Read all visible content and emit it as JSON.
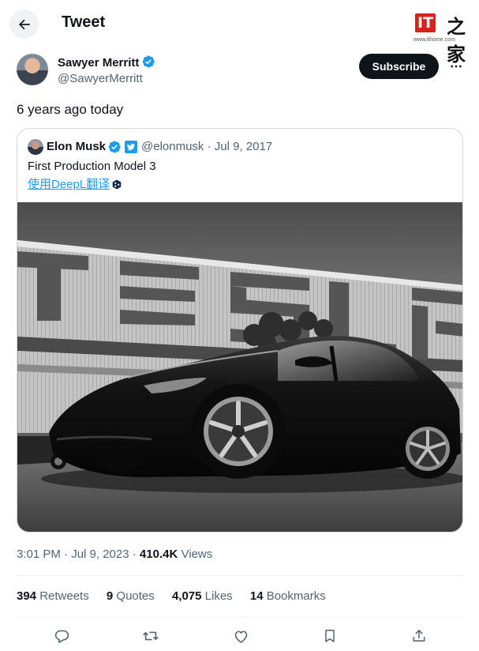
{
  "header": {
    "title": "Tweet"
  },
  "watermark": {
    "logo_it": "IT",
    "logo_glyph": "之家",
    "url": "www.ithome.com"
  },
  "author": {
    "name": "Sawyer Merritt",
    "handle": "@SawyerMerritt",
    "subscribe_label": "Subscribe"
  },
  "tweet": {
    "text": "6 years ago today"
  },
  "quote": {
    "name": "Elon Musk",
    "handle_date": "@elonmusk · Jul 9, 2017",
    "text": "First Production Model 3",
    "translate_label": "使用DeepL翻译"
  },
  "meta": {
    "time_date": "3:01 PM · Jul 9, 2023 · ",
    "views_count": "410.4K",
    "views_label": " Views"
  },
  "stats": [
    {
      "count": "394",
      "label": " Retweets"
    },
    {
      "count": "9",
      "label": " Quotes"
    },
    {
      "count": "4,075",
      "label": " Likes"
    },
    {
      "count": "14",
      "label": " Bookmarks"
    }
  ],
  "colors": {
    "accent": "#1d9bf0",
    "text": "#0f1419",
    "muted": "#536471",
    "border": "#cfd9de",
    "watermark_red": "#d7211d"
  },
  "icons": [
    "arrow-left-icon",
    "verified-badge-icon",
    "more-icon",
    "twitter-bird-icon",
    "deepl-icon",
    "reply-icon",
    "retweet-icon",
    "like-icon",
    "bookmark-icon",
    "share-icon"
  ]
}
